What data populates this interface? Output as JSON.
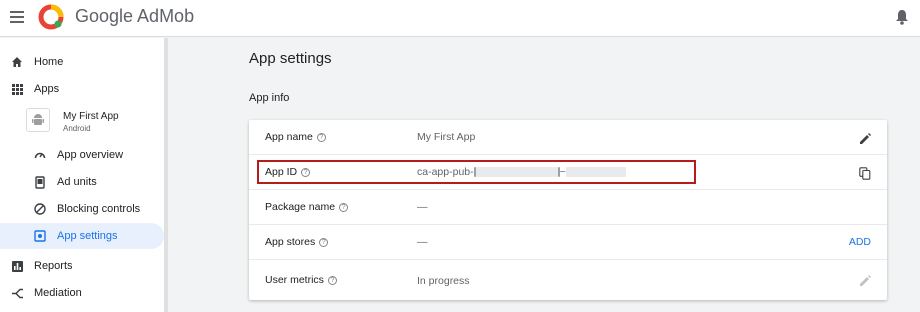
{
  "header": {
    "brand": "Google AdMob",
    "logo_colors": [
      "#ea4335",
      "#fbbc04",
      "#34a853"
    ]
  },
  "sidebar": {
    "items": [
      {
        "label": "Home",
        "icon": "home-icon"
      },
      {
        "label": "Apps",
        "icon": "apps-grid-icon"
      },
      {
        "label": "Reports",
        "icon": "reports-icon"
      },
      {
        "label": "Mediation",
        "icon": "mediation-icon"
      }
    ],
    "app": {
      "name": "My First App",
      "platform": "Android",
      "icon": "android-icon"
    },
    "sub_items": [
      {
        "label": "App overview",
        "icon": "dashboard-icon"
      },
      {
        "label": "Ad units",
        "icon": "ad-unit-icon"
      },
      {
        "label": "Blocking controls",
        "icon": "block-icon"
      },
      {
        "label": "App settings",
        "icon": "settings-icon",
        "active": true
      }
    ]
  },
  "main": {
    "title": "App settings",
    "section": "App info",
    "rows": [
      {
        "label": "App name",
        "value": "My First App",
        "action": "edit-icon"
      },
      {
        "label": "App ID",
        "value_prefix": "ca-app-pub-",
        "value_mid": "~",
        "action": "copy-icon"
      },
      {
        "label": "Package name",
        "value": "—"
      },
      {
        "label": "App stores",
        "value": "—",
        "action_label": "ADD"
      },
      {
        "label": "User metrics",
        "value": "In progress",
        "action": "edit-icon-disabled"
      }
    ],
    "help_glyph": "?"
  },
  "colors": {
    "accent": "#1a73e8",
    "highlight": "#b71c1c",
    "active_bg": "#e8f0fe"
  }
}
